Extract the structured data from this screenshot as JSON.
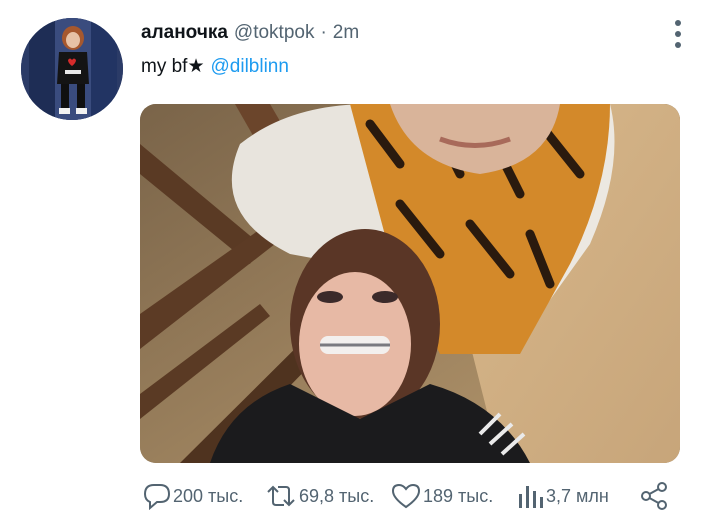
{
  "tweet": {
    "author": {
      "display_name": "аланочка",
      "handle": "@toktpok",
      "separator": "·",
      "time": "2m"
    },
    "text": "my bf★",
    "mention": "@dilblinn",
    "actions": {
      "replies": "200 тыс.",
      "retweets": "69,8 тыс.",
      "likes": "189 тыс.",
      "views": "3,7 млн"
    }
  },
  "colors": {
    "text": "#0f1419",
    "secondary": "#536471",
    "link": "#1d9bf0"
  },
  "icons": [
    "more-icon",
    "reply-icon",
    "retweet-icon",
    "like-icon",
    "views-icon",
    "share-icon"
  ]
}
